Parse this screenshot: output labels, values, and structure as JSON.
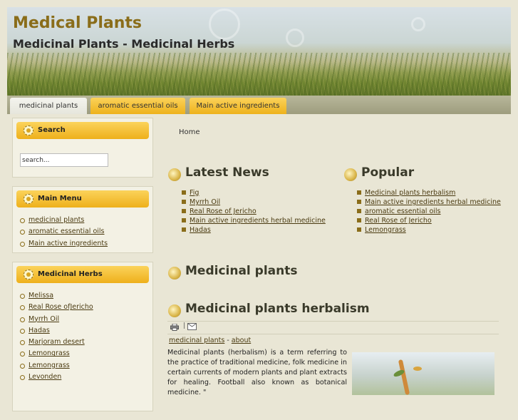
{
  "header": {
    "title": "Medical Plants",
    "slogan": "Medicinal Plants - Medicinal Herbs"
  },
  "nav": {
    "tabs": [
      {
        "label": "medicinal plants",
        "active": true
      },
      {
        "label": "aromatic essential oils",
        "active": false
      },
      {
        "label": "Main active ingredients",
        "active": false
      }
    ]
  },
  "sidebar": {
    "search": {
      "title": "Search",
      "placeholder": "search..."
    },
    "main_menu": {
      "title": "Main Menu",
      "items": [
        "medicinal plants",
        "aromatic essential oils",
        "Main active ingredients"
      ]
    },
    "herbs": {
      "title": "Medicinal Herbs",
      "items": [
        "Melissa",
        "Real Rose ofJericho",
        "Myrrh Oil",
        "Hadas",
        "Marjoram desert",
        "Lemongrass",
        "Lemongrass",
        "Levonden"
      ]
    }
  },
  "main": {
    "breadcrumb": "Home",
    "latest_news": {
      "title": "Latest News",
      "items": [
        "Fig",
        "Myrrh Oil",
        "Real Rose of Jericho",
        "Main active ingredients herbal medicine",
        "Hadas"
      ]
    },
    "popular": {
      "title": "Popular",
      "items": [
        "Medicinal plants herbalism",
        "Main active ingredients herbal medicine",
        "aromatic essential oils",
        "Real Rose of Jericho",
        "Lemongrass"
      ]
    },
    "section_title": "Medicinal plants",
    "article": {
      "title": "Medicinal plants herbalism",
      "toolbar_separator": "|",
      "category": "medicinal plants",
      "meta_sep": " - ",
      "section": "about",
      "text": "Medicinal plants (herbalism) is a term referring to the practice of traditional medicine, folk medicine in certain currents of modern plants and plant extracts for healing. Football also known as botanical medicine. \""
    }
  },
  "colors": {
    "accent": "#eeb21b",
    "background": "#e9e6d5",
    "title": "#8a6d1a"
  }
}
